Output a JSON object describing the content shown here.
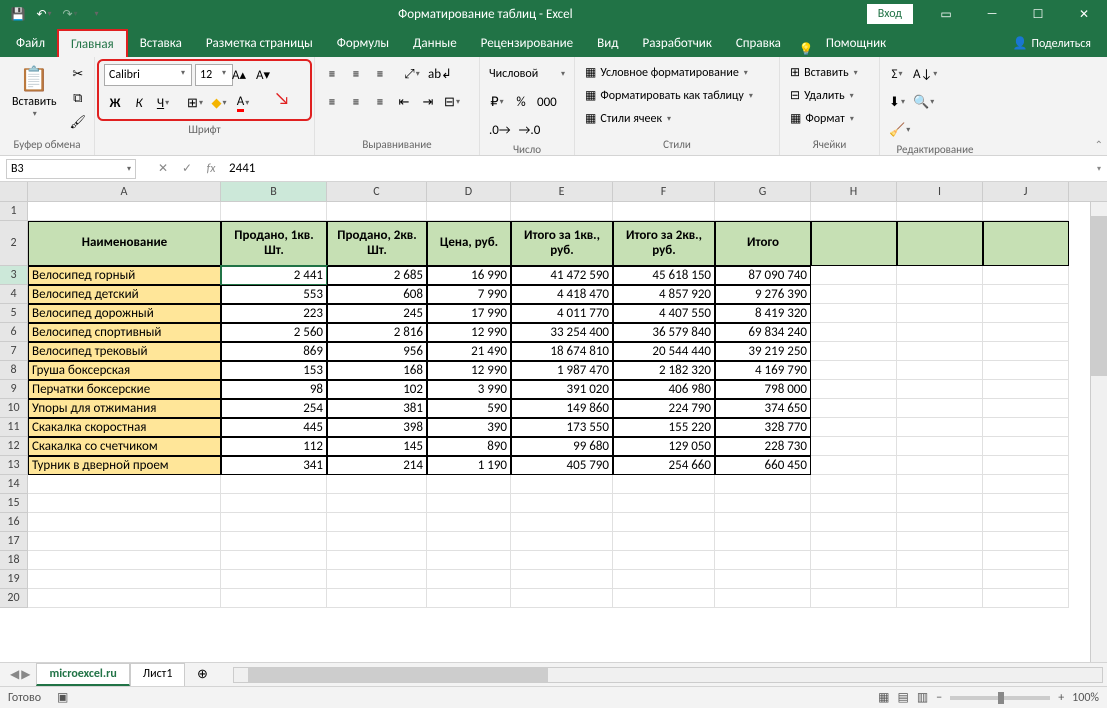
{
  "title": "Форматирование таблиц - Excel",
  "signin": "Вход",
  "tabs": [
    "Файл",
    "Главная",
    "Вставка",
    "Разметка страницы",
    "Формулы",
    "Данные",
    "Рецензирование",
    "Вид",
    "Разработчик",
    "Справка",
    "Помощник"
  ],
  "active_tab": 1,
  "share": "Поделиться",
  "ribbon": {
    "clipboard": {
      "paste": "Вставить",
      "label": "Буфер обмена"
    },
    "font": {
      "name": "Calibri",
      "size": "12",
      "label": "Шрифт",
      "bold": "Ж",
      "italic": "К",
      "underline": "Ч"
    },
    "alignment": {
      "label": "Выравнивание"
    },
    "number": {
      "label": "Число",
      "format": "Числовой"
    },
    "styles": {
      "label": "Стили",
      "cond": "Условное форматирование",
      "table": "Форматировать как таблицу",
      "cell": "Стили ячеек"
    },
    "cells": {
      "label": "Ячейки",
      "insert": "Вставить",
      "delete": "Удалить",
      "format": "Формат"
    },
    "editing": {
      "label": "Редактирование"
    }
  },
  "namebox": "B3",
  "formula": "2441",
  "columns": [
    "A",
    "B",
    "C",
    "D",
    "E",
    "F",
    "G",
    "H",
    "I",
    "J"
  ],
  "header_row": [
    "Наименование",
    "Продано, 1кв. Шт.",
    "Продано, 2кв. Шт.",
    "Цена, руб.",
    "Итого за 1кв., руб.",
    "Итого за 2кв., руб.",
    "Итого"
  ],
  "rows": [
    {
      "n": 3,
      "name": "Велосипед горный",
      "v": [
        "2 441",
        "2 685",
        "16 990",
        "41 472 590",
        "45 618 150",
        "87 090 740"
      ]
    },
    {
      "n": 4,
      "name": "Велосипед детский",
      "v": [
        "553",
        "608",
        "7 990",
        "4 418 470",
        "4 857 920",
        "9 276 390"
      ]
    },
    {
      "n": 5,
      "name": "Велосипед дорожный",
      "v": [
        "223",
        "245",
        "17 990",
        "4 011 770",
        "4 407 550",
        "8 419 320"
      ]
    },
    {
      "n": 6,
      "name": "Велосипед спортивный",
      "v": [
        "2 560",
        "2 816",
        "12 990",
        "33 254 400",
        "36 579 840",
        "69 834 240"
      ]
    },
    {
      "n": 7,
      "name": "Велосипед трековый",
      "v": [
        "869",
        "956",
        "21 490",
        "18 674 810",
        "20 544 440",
        "39 219 250"
      ]
    },
    {
      "n": 8,
      "name": "Груша боксерская",
      "v": [
        "153",
        "168",
        "12 990",
        "1 987 470",
        "2 182 320",
        "4 169 790"
      ]
    },
    {
      "n": 9,
      "name": "Перчатки боксерские",
      "v": [
        "98",
        "102",
        "3 990",
        "391 020",
        "406 980",
        "798 000"
      ]
    },
    {
      "n": 10,
      "name": "Упоры для отжимания",
      "v": [
        "254",
        "381",
        "590",
        "149 860",
        "224 790",
        "374 650"
      ]
    },
    {
      "n": 11,
      "name": "Скакалка скоростная",
      "v": [
        "445",
        "398",
        "390",
        "173 550",
        "155 220",
        "328 770"
      ]
    },
    {
      "n": 12,
      "name": "Скакалка со счетчиком",
      "v": [
        "112",
        "145",
        "890",
        "99 680",
        "129 050",
        "228 730"
      ]
    },
    {
      "n": 13,
      "name": "Турник в дверной проем",
      "v": [
        "341",
        "214",
        "1 190",
        "405 790",
        "254 660",
        "660 450"
      ]
    }
  ],
  "empty_rows": [
    14,
    15,
    16,
    17,
    18,
    19,
    20
  ],
  "sheets": [
    "microexcel.ru",
    "Лист1"
  ],
  "active_sheet": 0,
  "status": "Готово",
  "zoom": "100%"
}
